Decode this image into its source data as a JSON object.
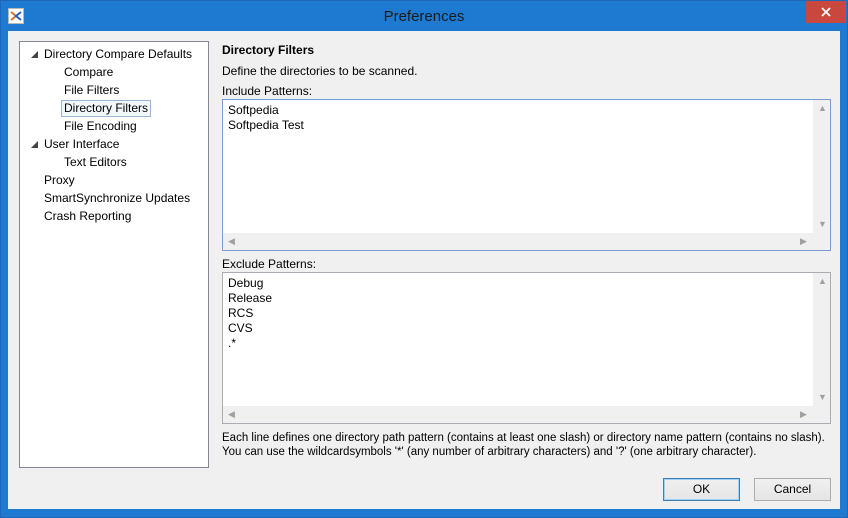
{
  "window": {
    "title": "Preferences"
  },
  "tree": {
    "items": [
      {
        "label": "Directory Compare Defaults",
        "expanded": true
      },
      {
        "label": "Compare"
      },
      {
        "label": "File Filters"
      },
      {
        "label": "Directory Filters",
        "selected": true
      },
      {
        "label": "File Encoding"
      },
      {
        "label": "User Interface",
        "expanded": true
      },
      {
        "label": "Text Editors"
      },
      {
        "label": "Proxy"
      },
      {
        "label": "SmartSynchronize Updates"
      },
      {
        "label": "Crash Reporting"
      }
    ]
  },
  "panel": {
    "title": "Directory Filters",
    "description": "Define the directories to be scanned.",
    "include_label": "Include Patterns:",
    "include_lines": [
      "Softpedia",
      "Softpedia Test"
    ],
    "exclude_label": "Exclude Patterns:",
    "exclude_lines": [
      "Debug",
      "Release",
      "RCS",
      "CVS",
      ".*"
    ],
    "help_line1": "Each line defines one directory path pattern (contains at least one slash) or directory name pattern (contains no slash).",
    "help_line2": "You can use the wildcardsymbols '*' (any number of arbitrary characters) and '?' (one arbitrary character)."
  },
  "buttons": {
    "ok": "OK",
    "cancel": "Cancel"
  },
  "colors": {
    "titlebar": "#1e7ad0",
    "close": "#c9473d",
    "focus_border": "#7a9cd3"
  },
  "icons": {
    "app": "app-icon",
    "close": "close-icon",
    "expand": "expand-arrow-icon"
  }
}
